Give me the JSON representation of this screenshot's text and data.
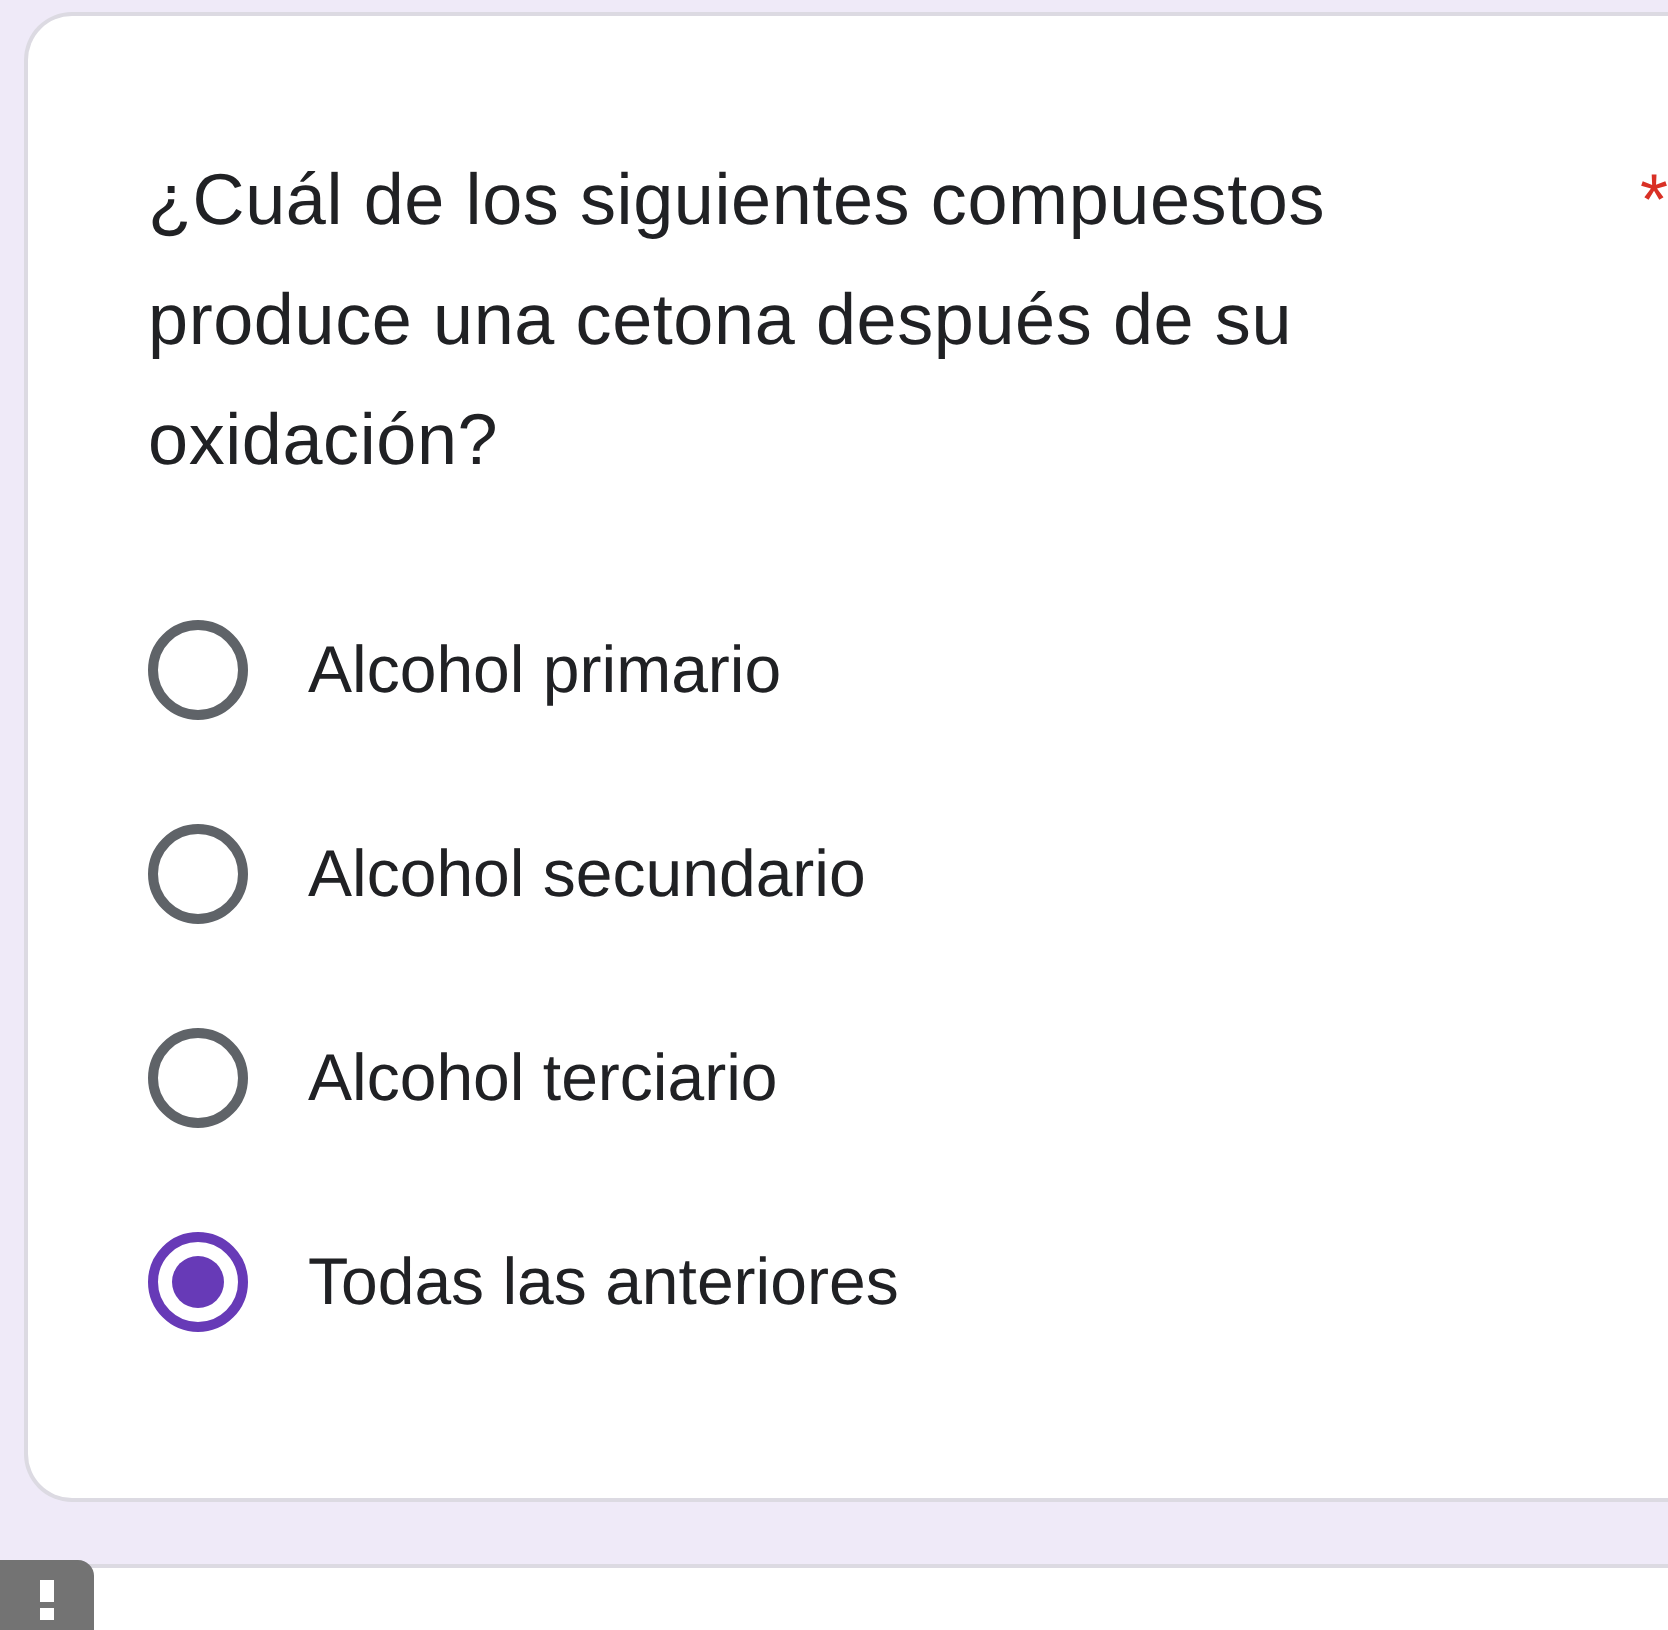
{
  "question": {
    "text": "¿Cuál de los siguientes compuestos produce una cetona después de su oxidación?",
    "required_mark": "*"
  },
  "options": [
    {
      "label": "Alcohol primario",
      "selected": false
    },
    {
      "label": "Alcohol secundario",
      "selected": false
    },
    {
      "label": "Alcohol terciario",
      "selected": false
    },
    {
      "label": "Todas las anteriores",
      "selected": true
    }
  ]
}
